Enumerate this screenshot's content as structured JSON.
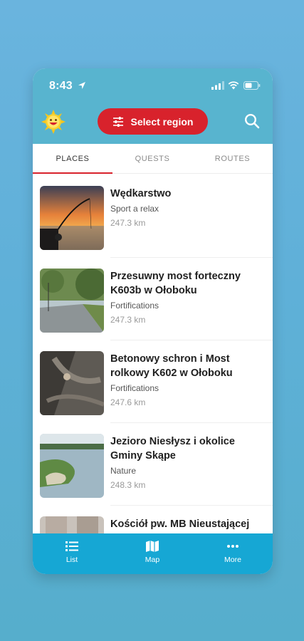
{
  "status": {
    "time": "8:43"
  },
  "header": {
    "select_region_label": "Select region"
  },
  "tabs": [
    {
      "label": "PLACES",
      "active": true
    },
    {
      "label": "QUESTS",
      "active": false
    },
    {
      "label": "ROUTES",
      "active": false
    }
  ],
  "places": [
    {
      "title": "Wędkarstwo",
      "category": "Sport a relax",
      "distance": "247.3 km"
    },
    {
      "title": "Przesuwny most forteczny K603b w Ołoboku",
      "category": "Fortifications",
      "distance": "247.3 km"
    },
    {
      "title": "Betonowy schron i Most rolkowy K602 w Ołoboku",
      "category": "Fortifications",
      "distance": "247.6 km"
    },
    {
      "title": "Jezioro Niesłysz i okolice Gminy Skąpe",
      "category": "Nature",
      "distance": "248.3 km"
    },
    {
      "title": "Kościół pw. MB Nieustającej",
      "category": "",
      "distance": ""
    }
  ],
  "nav": [
    {
      "label": "List",
      "icon": "list-icon"
    },
    {
      "label": "Map",
      "icon": "map-icon"
    },
    {
      "label": "More",
      "icon": "more-icon"
    }
  ],
  "colors": {
    "header": "#58b4cf",
    "accent": "#d8222c",
    "nav": "#16a7d4"
  }
}
